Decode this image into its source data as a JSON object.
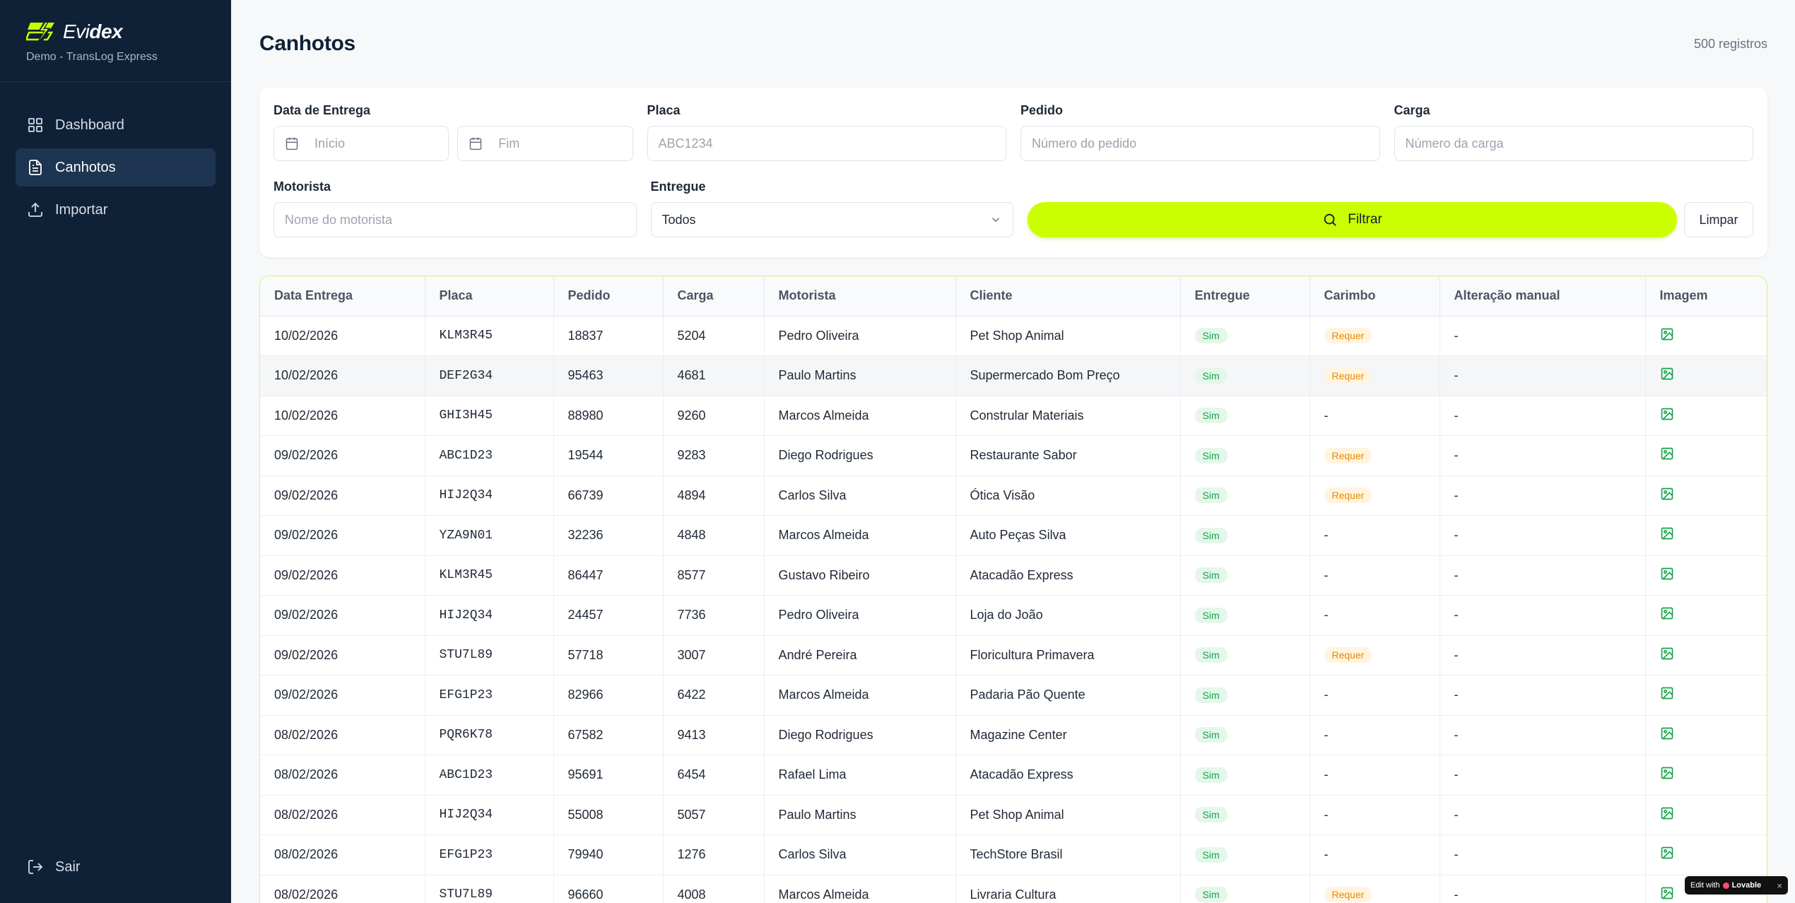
{
  "brand": {
    "name_a": "Evi",
    "name_b": "dex",
    "subtitle": "Demo - TransLog Express"
  },
  "nav": [
    {
      "label": "Dashboard",
      "icon": "dashboard-icon",
      "active": false
    },
    {
      "label": "Canhotos",
      "icon": "document-icon",
      "active": true
    },
    {
      "label": "Importar",
      "icon": "upload-icon",
      "active": false
    }
  ],
  "logout_label": "Sair",
  "page": {
    "title": "Canhotos",
    "count": "500 registros"
  },
  "filters": {
    "date_label": "Data de Entrega",
    "date_start_placeholder": "Início",
    "date_end_placeholder": "Fim",
    "plate_label": "Placa",
    "plate_placeholder": "ABC1234",
    "order_label": "Pedido",
    "order_placeholder": "Número do pedido",
    "load_label": "Carga",
    "load_placeholder": "Número da carga",
    "driver_label": "Motorista",
    "driver_placeholder": "Nome do motorista",
    "delivered_label": "Entregue",
    "delivered_value": "Todos",
    "filter_button": "Filtrar",
    "clear_button": "Limpar"
  },
  "table": {
    "columns": [
      "Data Entrega",
      "Placa",
      "Pedido",
      "Carga",
      "Motorista",
      "Cliente",
      "Entregue",
      "Carimbo",
      "Alteração manual",
      "Imagem"
    ],
    "rows": [
      [
        "10/02/2026",
        "KLM3R45",
        "18837",
        "5204",
        "Pedro Oliveira",
        "Pet Shop Animal",
        "Sim",
        "Requer",
        "-"
      ],
      [
        "10/02/2026",
        "DEF2G34",
        "95463",
        "4681",
        "Paulo Martins",
        "Supermercado Bom Preço",
        "Sim",
        "Requer",
        "-"
      ],
      [
        "10/02/2026",
        "GHI3H45",
        "88980",
        "9260",
        "Marcos Almeida",
        "Constrular Materiais",
        "Sim",
        "-",
        "-"
      ],
      [
        "09/02/2026",
        "ABC1D23",
        "19544",
        "9283",
        "Diego Rodrigues",
        "Restaurante Sabor",
        "Sim",
        "Requer",
        "-"
      ],
      [
        "09/02/2026",
        "HIJ2Q34",
        "66739",
        "4894",
        "Carlos Silva",
        "Ótica Visão",
        "Sim",
        "Requer",
        "-"
      ],
      [
        "09/02/2026",
        "YZA9N01",
        "32236",
        "4848",
        "Marcos Almeida",
        "Auto Peças Silva",
        "Sim",
        "-",
        "-"
      ],
      [
        "09/02/2026",
        "KLM3R45",
        "86447",
        "8577",
        "Gustavo Ribeiro",
        "Atacadão Express",
        "Sim",
        "-",
        "-"
      ],
      [
        "09/02/2026",
        "HIJ2Q34",
        "24457",
        "7736",
        "Pedro Oliveira",
        "Loja do João",
        "Sim",
        "-",
        "-"
      ],
      [
        "09/02/2026",
        "STU7L89",
        "57718",
        "3007",
        "André Pereira",
        "Floricultura Primavera",
        "Sim",
        "Requer",
        "-"
      ],
      [
        "09/02/2026",
        "EFG1P23",
        "82966",
        "6422",
        "Marcos Almeida",
        "Padaria Pão Quente",
        "Sim",
        "-",
        "-"
      ],
      [
        "08/02/2026",
        "PQR6K78",
        "67582",
        "9413",
        "Diego Rodrigues",
        "Magazine Center",
        "Sim",
        "-",
        "-"
      ],
      [
        "08/02/2026",
        "ABC1D23",
        "95691",
        "6454",
        "Rafael Lima",
        "Atacadão Express",
        "Sim",
        "-",
        "-"
      ],
      [
        "08/02/2026",
        "HIJ2Q34",
        "55008",
        "5057",
        "Paulo Martins",
        "Pet Shop Animal",
        "Sim",
        "-",
        "-"
      ],
      [
        "08/02/2026",
        "EFG1P23",
        "79940",
        "1276",
        "Carlos Silva",
        "TechStore Brasil",
        "Sim",
        "-",
        "-"
      ],
      [
        "08/02/2026",
        "STU7L89",
        "96660",
        "4008",
        "Marcos Almeida",
        "Livraria Cultura",
        "Sim",
        "Requer",
        "-"
      ]
    ]
  },
  "lovable": {
    "prefix": "Edit with",
    "brand": "Lovable",
    "close": "×"
  },
  "colors": {
    "sidebar": "#0f2137",
    "accent": "#cbff00",
    "success": "#16a34a",
    "warning": "#ea8a00"
  }
}
